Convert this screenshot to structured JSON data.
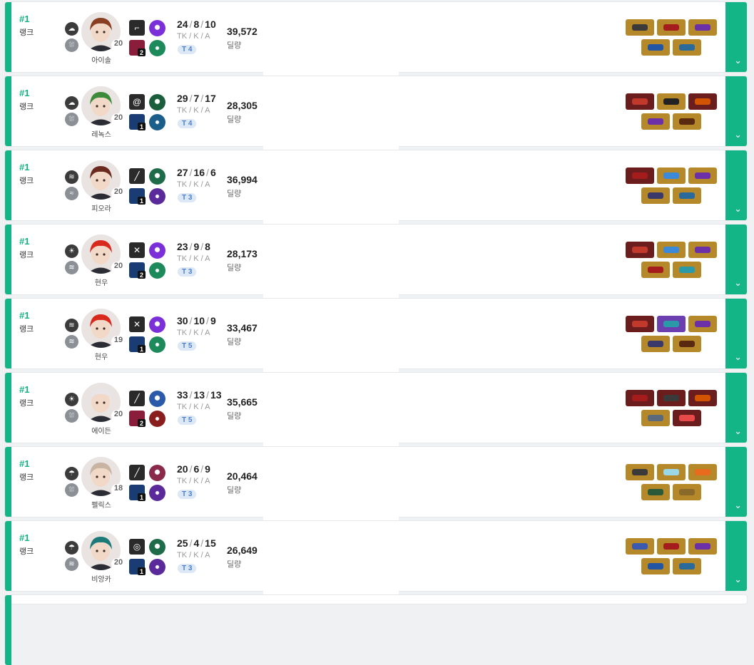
{
  "labels": {
    "kda_label": "TK / K / A",
    "dmg_label": "딜량",
    "rank_label": "랭크",
    "kda_sep": "/"
  },
  "colors": {
    "accent": "#13b486",
    "tier_text": "#4a82c9",
    "tier_bg": "#dde8f6"
  },
  "games": [
    {
      "rank": "#1",
      "character": "아이솔",
      "level": "20",
      "tk": "24",
      "k": "8",
      "a": "10",
      "tier": "T 4",
      "damage": "39,572",
      "tactical_level": "2",
      "weather_icons": [
        "cloud-icon",
        "cloud-rain-icon"
      ],
      "weapon_icon": "pistol-icon",
      "trait_colors": [
        "#7a2fd8",
        "#1c8a5a"
      ],
      "tactical_color": "#8a1d3a",
      "hair": "#8a3f22",
      "skin": "#f1d8c7",
      "items": [
        {
          "bg": "#b5892a",
          "fg": "#3a3a3a"
        },
        {
          "bg": "#b5892a",
          "fg": "#a51c1c"
        },
        {
          "bg": "#b5892a",
          "fg": "#6b2fa8"
        },
        {
          "bg": "#b5892a",
          "fg": "#2255a4"
        },
        {
          "bg": "#b5892a",
          "fg": "#2a6a9a"
        }
      ]
    },
    {
      "rank": "#1",
      "character": "레녹스",
      "level": "20",
      "tk": "29",
      "k": "7",
      "a": "17",
      "tier": "T 4",
      "damage": "28,305",
      "tactical_level": "1",
      "weather_icons": [
        "cloud-icon",
        "cloud-rain-icon"
      ],
      "weapon_icon": "whip-icon",
      "trait_colors": [
        "#1b5e3c",
        "#1b5e8a"
      ],
      "tactical_color": "#1a3c75",
      "hair": "#3c8a3a",
      "skin": "#f1d8c7",
      "items": [
        {
          "bg": "#6b1d1d",
          "fg": "#c0392b"
        },
        {
          "bg": "#b5892a",
          "fg": "#222"
        },
        {
          "bg": "#6b1d1d",
          "fg": "#d35400"
        },
        {
          "bg": "#b5892a",
          "fg": "#6b2fa8"
        },
        {
          "bg": "#b5892a",
          "fg": "#5a2a10"
        }
      ]
    },
    {
      "rank": "#1",
      "character": "피오라",
      "level": "20",
      "tk": "27",
      "k": "16",
      "a": "6",
      "tier": "T 3",
      "damage": "36,994",
      "tactical_level": "1",
      "weather_icons": [
        "tornado-icon",
        "wind-icon"
      ],
      "weapon_icon": "rapier-icon",
      "trait_colors": [
        "#1e6b4a",
        "#5a2a9a"
      ],
      "tactical_color": "#1a3c75",
      "hair": "#6b2a1e",
      "skin": "#f1d8c7",
      "items": [
        {
          "bg": "#6b1d1d",
          "fg": "#a51c1c"
        },
        {
          "bg": "#b5892a",
          "fg": "#3a8ad8"
        },
        {
          "bg": "#b5892a",
          "fg": "#6b2fa8"
        },
        {
          "bg": "#b5892a",
          "fg": "#3a3a6a"
        },
        {
          "bg": "#b5892a",
          "fg": "#2a6a9a"
        }
      ]
    },
    {
      "rank": "#1",
      "character": "현우",
      "level": "20",
      "tk": "23",
      "k": "9",
      "a": "8",
      "tier": "T 3",
      "damage": "28,173",
      "tactical_level": "2",
      "weather_icons": [
        "sun-icon",
        "fog-icon"
      ],
      "weapon_icon": "tonfa-icon",
      "trait_colors": [
        "#7a2fd8",
        "#1c8a5a"
      ],
      "tactical_color": "#1a3c75",
      "hair": "#d8291c",
      "skin": "#f1d8c7",
      "items": [
        {
          "bg": "#6b1d1d",
          "fg": "#c0392b"
        },
        {
          "bg": "#b5892a",
          "fg": "#3a8ad8"
        },
        {
          "bg": "#b5892a",
          "fg": "#6b2fa8"
        },
        {
          "bg": "#b5892a",
          "fg": "#a51c1c"
        },
        {
          "bg": "#b5892a",
          "fg": "#2a9aa8"
        }
      ]
    },
    {
      "rank": "#1",
      "character": "현우",
      "level": "19",
      "tk": "30",
      "k": "10",
      "a": "9",
      "tier": "T 5",
      "damage": "33,467",
      "tactical_level": "1",
      "weather_icons": [
        "tornado-icon",
        "fog-icon"
      ],
      "weapon_icon": "tonfa-icon",
      "trait_colors": [
        "#7a2fd8",
        "#1c8a5a"
      ],
      "tactical_color": "#1a3c75",
      "hair": "#d8291c",
      "skin": "#f1d8c7",
      "items": [
        {
          "bg": "#6b1d1d",
          "fg": "#c0392b"
        },
        {
          "bg": "#6b3fb0",
          "fg": "#2a9aa8"
        },
        {
          "bg": "#b5892a",
          "fg": "#6b2fa8"
        },
        {
          "bg": "#b5892a",
          "fg": "#3a3a6a"
        },
        {
          "bg": "#b5892a",
          "fg": "#5a2a10"
        }
      ]
    },
    {
      "rank": "#1",
      "character": "에이든",
      "level": "20",
      "tk": "33",
      "k": "13",
      "a": "13",
      "tier": "T 5",
      "damage": "35,665",
      "tactical_level": "2",
      "weather_icons": [
        "sun-icon",
        "cloud-rain-icon"
      ],
      "weapon_icon": "sword-icon",
      "trait_colors": [
        "#2a5aa8",
        "#8a1d1d"
      ],
      "tactical_color": "#8a1d3a",
      "hair": "#e8e4e8",
      "skin": "#f1d8c7",
      "items": [
        {
          "bg": "#6b1d1d",
          "fg": "#a51c1c"
        },
        {
          "bg": "#6b1d1d",
          "fg": "#3a3a3a"
        },
        {
          "bg": "#6b1d1d",
          "fg": "#d35400"
        },
        {
          "bg": "#b5892a",
          "fg": "#5a6a7a"
        },
        {
          "bg": "#6b1d1d",
          "fg": "#e84a4a"
        }
      ]
    },
    {
      "rank": "#1",
      "character": "펠릭스",
      "level": "18",
      "tk": "20",
      "k": "6",
      "a": "9",
      "tier": "T 3",
      "damage": "20,464",
      "tactical_level": "1",
      "weather_icons": [
        "cloud-showers-icon",
        "cloud-rain-icon"
      ],
      "weapon_icon": "spear-icon",
      "trait_colors": [
        "#8a2a4a",
        "#5a2a9a"
      ],
      "tactical_color": "#1a3c75",
      "hair": "#c7b4a2",
      "skin": "#f1d8c7",
      "items": [
        {
          "bg": "#b5892a",
          "fg": "#3a3a3a"
        },
        {
          "bg": "#b5892a",
          "fg": "#9ad8e8"
        },
        {
          "bg": "#b5892a",
          "fg": "#e86a1c"
        },
        {
          "bg": "#b5892a",
          "fg": "#2a5a3a"
        },
        {
          "bg": "#b5892a",
          "fg": "#8a6a2a"
        }
      ]
    },
    {
      "rank": "#1",
      "character": "비앙카",
      "level": "20",
      "tk": "25",
      "k": "4",
      "a": "15",
      "tier": "T 3",
      "damage": "26,649",
      "tactical_level": "1",
      "weather_icons": [
        "cloud-showers-icon",
        "fog-icon"
      ],
      "weapon_icon": "arcana-icon",
      "trait_colors": [
        "#1e6b4a",
        "#5a2a9a"
      ],
      "tactical_color": "#1a3c75",
      "hair": "#1c7a78",
      "skin": "#f1d8c7",
      "items": [
        {
          "bg": "#b5892a",
          "fg": "#3a5ab0"
        },
        {
          "bg": "#b5892a",
          "fg": "#a51c1c"
        },
        {
          "bg": "#b5892a",
          "fg": "#6b2fa8"
        },
        {
          "bg": "#b5892a",
          "fg": "#2255a4"
        },
        {
          "bg": "#b5892a",
          "fg": "#2a6a9a"
        }
      ]
    }
  ]
}
